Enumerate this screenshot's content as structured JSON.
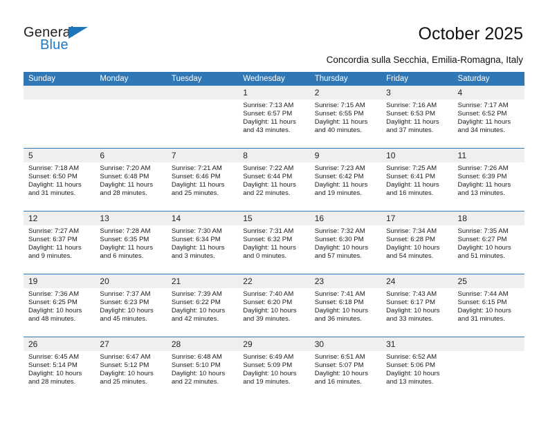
{
  "brand": {
    "name_top": "General",
    "name_bottom": "Blue",
    "triangle_icon": "blue-triangle-logo-mark",
    "color_dark": "#231f20",
    "color_blue": "#1e78c8"
  },
  "header": {
    "title": "October 2025",
    "subtitle": "Concordia sulla Secchia, Emilia-Romagna, Italy",
    "accent_color": "#3077b6",
    "daynum_band_color": "#efefef"
  },
  "calendar": {
    "weekday_headers": [
      "Sunday",
      "Monday",
      "Tuesday",
      "Wednesday",
      "Thursday",
      "Friday",
      "Saturday"
    ],
    "weeks": [
      [
        {
          "day": "",
          "empty": true,
          "sunrise": "",
          "sunset": "",
          "daylight_line1": "",
          "daylight_line2": ""
        },
        {
          "day": "",
          "empty": true,
          "sunrise": "",
          "sunset": "",
          "daylight_line1": "",
          "daylight_line2": ""
        },
        {
          "day": "",
          "empty": true,
          "sunrise": "",
          "sunset": "",
          "daylight_line1": "",
          "daylight_line2": ""
        },
        {
          "day": "1",
          "empty": false,
          "sunrise": "Sunrise: 7:13 AM",
          "sunset": "Sunset: 6:57 PM",
          "daylight_line1": "Daylight: 11 hours",
          "daylight_line2": "and 43 minutes."
        },
        {
          "day": "2",
          "empty": false,
          "sunrise": "Sunrise: 7:15 AM",
          "sunset": "Sunset: 6:55 PM",
          "daylight_line1": "Daylight: 11 hours",
          "daylight_line2": "and 40 minutes."
        },
        {
          "day": "3",
          "empty": false,
          "sunrise": "Sunrise: 7:16 AM",
          "sunset": "Sunset: 6:53 PM",
          "daylight_line1": "Daylight: 11 hours",
          "daylight_line2": "and 37 minutes."
        },
        {
          "day": "4",
          "empty": false,
          "sunrise": "Sunrise: 7:17 AM",
          "sunset": "Sunset: 6:52 PM",
          "daylight_line1": "Daylight: 11 hours",
          "daylight_line2": "and 34 minutes."
        }
      ],
      [
        {
          "day": "5",
          "empty": false,
          "sunrise": "Sunrise: 7:18 AM",
          "sunset": "Sunset: 6:50 PM",
          "daylight_line1": "Daylight: 11 hours",
          "daylight_line2": "and 31 minutes."
        },
        {
          "day": "6",
          "empty": false,
          "sunrise": "Sunrise: 7:20 AM",
          "sunset": "Sunset: 6:48 PM",
          "daylight_line1": "Daylight: 11 hours",
          "daylight_line2": "and 28 minutes."
        },
        {
          "day": "7",
          "empty": false,
          "sunrise": "Sunrise: 7:21 AM",
          "sunset": "Sunset: 6:46 PM",
          "daylight_line1": "Daylight: 11 hours",
          "daylight_line2": "and 25 minutes."
        },
        {
          "day": "8",
          "empty": false,
          "sunrise": "Sunrise: 7:22 AM",
          "sunset": "Sunset: 6:44 PM",
          "daylight_line1": "Daylight: 11 hours",
          "daylight_line2": "and 22 minutes."
        },
        {
          "day": "9",
          "empty": false,
          "sunrise": "Sunrise: 7:23 AM",
          "sunset": "Sunset: 6:42 PM",
          "daylight_line1": "Daylight: 11 hours",
          "daylight_line2": "and 19 minutes."
        },
        {
          "day": "10",
          "empty": false,
          "sunrise": "Sunrise: 7:25 AM",
          "sunset": "Sunset: 6:41 PM",
          "daylight_line1": "Daylight: 11 hours",
          "daylight_line2": "and 16 minutes."
        },
        {
          "day": "11",
          "empty": false,
          "sunrise": "Sunrise: 7:26 AM",
          "sunset": "Sunset: 6:39 PM",
          "daylight_line1": "Daylight: 11 hours",
          "daylight_line2": "and 13 minutes."
        }
      ],
      [
        {
          "day": "12",
          "empty": false,
          "sunrise": "Sunrise: 7:27 AM",
          "sunset": "Sunset: 6:37 PM",
          "daylight_line1": "Daylight: 11 hours",
          "daylight_line2": "and 9 minutes."
        },
        {
          "day": "13",
          "empty": false,
          "sunrise": "Sunrise: 7:28 AM",
          "sunset": "Sunset: 6:35 PM",
          "daylight_line1": "Daylight: 11 hours",
          "daylight_line2": "and 6 minutes."
        },
        {
          "day": "14",
          "empty": false,
          "sunrise": "Sunrise: 7:30 AM",
          "sunset": "Sunset: 6:34 PM",
          "daylight_line1": "Daylight: 11 hours",
          "daylight_line2": "and 3 minutes."
        },
        {
          "day": "15",
          "empty": false,
          "sunrise": "Sunrise: 7:31 AM",
          "sunset": "Sunset: 6:32 PM",
          "daylight_line1": "Daylight: 11 hours",
          "daylight_line2": "and 0 minutes."
        },
        {
          "day": "16",
          "empty": false,
          "sunrise": "Sunrise: 7:32 AM",
          "sunset": "Sunset: 6:30 PM",
          "daylight_line1": "Daylight: 10 hours",
          "daylight_line2": "and 57 minutes."
        },
        {
          "day": "17",
          "empty": false,
          "sunrise": "Sunrise: 7:34 AM",
          "sunset": "Sunset: 6:28 PM",
          "daylight_line1": "Daylight: 10 hours",
          "daylight_line2": "and 54 minutes."
        },
        {
          "day": "18",
          "empty": false,
          "sunrise": "Sunrise: 7:35 AM",
          "sunset": "Sunset: 6:27 PM",
          "daylight_line1": "Daylight: 10 hours",
          "daylight_line2": "and 51 minutes."
        }
      ],
      [
        {
          "day": "19",
          "empty": false,
          "sunrise": "Sunrise: 7:36 AM",
          "sunset": "Sunset: 6:25 PM",
          "daylight_line1": "Daylight: 10 hours",
          "daylight_line2": "and 48 minutes."
        },
        {
          "day": "20",
          "empty": false,
          "sunrise": "Sunrise: 7:37 AM",
          "sunset": "Sunset: 6:23 PM",
          "daylight_line1": "Daylight: 10 hours",
          "daylight_line2": "and 45 minutes."
        },
        {
          "day": "21",
          "empty": false,
          "sunrise": "Sunrise: 7:39 AM",
          "sunset": "Sunset: 6:22 PM",
          "daylight_line1": "Daylight: 10 hours",
          "daylight_line2": "and 42 minutes."
        },
        {
          "day": "22",
          "empty": false,
          "sunrise": "Sunrise: 7:40 AM",
          "sunset": "Sunset: 6:20 PM",
          "daylight_line1": "Daylight: 10 hours",
          "daylight_line2": "and 39 minutes."
        },
        {
          "day": "23",
          "empty": false,
          "sunrise": "Sunrise: 7:41 AM",
          "sunset": "Sunset: 6:18 PM",
          "daylight_line1": "Daylight: 10 hours",
          "daylight_line2": "and 36 minutes."
        },
        {
          "day": "24",
          "empty": false,
          "sunrise": "Sunrise: 7:43 AM",
          "sunset": "Sunset: 6:17 PM",
          "daylight_line1": "Daylight: 10 hours",
          "daylight_line2": "and 33 minutes."
        },
        {
          "day": "25",
          "empty": false,
          "sunrise": "Sunrise: 7:44 AM",
          "sunset": "Sunset: 6:15 PM",
          "daylight_line1": "Daylight: 10 hours",
          "daylight_line2": "and 31 minutes."
        }
      ],
      [
        {
          "day": "26",
          "empty": false,
          "sunrise": "Sunrise: 6:45 AM",
          "sunset": "Sunset: 5:14 PM",
          "daylight_line1": "Daylight: 10 hours",
          "daylight_line2": "and 28 minutes."
        },
        {
          "day": "27",
          "empty": false,
          "sunrise": "Sunrise: 6:47 AM",
          "sunset": "Sunset: 5:12 PM",
          "daylight_line1": "Daylight: 10 hours",
          "daylight_line2": "and 25 minutes."
        },
        {
          "day": "28",
          "empty": false,
          "sunrise": "Sunrise: 6:48 AM",
          "sunset": "Sunset: 5:10 PM",
          "daylight_line1": "Daylight: 10 hours",
          "daylight_line2": "and 22 minutes."
        },
        {
          "day": "29",
          "empty": false,
          "sunrise": "Sunrise: 6:49 AM",
          "sunset": "Sunset: 5:09 PM",
          "daylight_line1": "Daylight: 10 hours",
          "daylight_line2": "and 19 minutes."
        },
        {
          "day": "30",
          "empty": false,
          "sunrise": "Sunrise: 6:51 AM",
          "sunset": "Sunset: 5:07 PM",
          "daylight_line1": "Daylight: 10 hours",
          "daylight_line2": "and 16 minutes."
        },
        {
          "day": "31",
          "empty": false,
          "sunrise": "Sunrise: 6:52 AM",
          "sunset": "Sunset: 5:06 PM",
          "daylight_line1": "Daylight: 10 hours",
          "daylight_line2": "and 13 minutes."
        },
        {
          "day": "",
          "empty": true,
          "sunrise": "",
          "sunset": "",
          "daylight_line1": "",
          "daylight_line2": ""
        }
      ]
    ]
  }
}
